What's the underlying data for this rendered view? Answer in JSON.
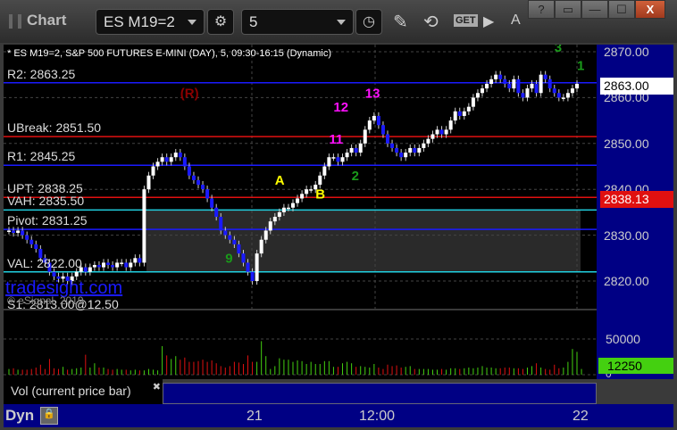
{
  "window": {
    "title": "Chart",
    "symbol": "ES M19=2",
    "interval": "5",
    "help": "?",
    "minimize": "—",
    "maximize": "☐",
    "close": "X"
  },
  "toolbar": {
    "pencil": "✎",
    "get": "GET",
    "play": "▶",
    "alert": "A"
  },
  "chart": {
    "description": "* ES M19=2, S&P 500 FUTURES E-MINI (DAY), 5, 09:30-16:15 (Dynamic)",
    "watermark": "tradesight.com",
    "copyright": "© eSignal, 2019",
    "current_price": "2863.00",
    "marker_price": "2838.13",
    "price_ticks": [
      "2870.00",
      "2860.00",
      "2850.00",
      "2840.00",
      "2830.00",
      "2820.00"
    ]
  },
  "levels": [
    {
      "label": "R2: 2863.25",
      "price": 2863.25,
      "color": "#1a1aff"
    },
    {
      "label": "UBreak: 2851.50",
      "price": 2851.5,
      "color": "#e01010"
    },
    {
      "label": "R1: 2845.25",
      "price": 2845.25,
      "color": "#1a1aff"
    },
    {
      "label": "UPT: 2838.25",
      "price": 2838.25,
      "color": "#e01010"
    },
    {
      "label": "VAH: 2835.50",
      "price": 2835.5,
      "color": "#20d0e0"
    },
    {
      "label": "Pivot: 2831.25",
      "price": 2831.25,
      "color": "#1a1aff"
    },
    {
      "label": "VAL: 2822.00",
      "price": 2822.0,
      "color": "#20d0e0"
    },
    {
      "label": "S1: 2813.00@12.50",
      "price": 2813.0,
      "color": "#1a1aff"
    }
  ],
  "volume": {
    "legend": "Vol (current price bar)",
    "current": "12250",
    "ticks": [
      "50000",
      "0"
    ]
  },
  "time_axis": {
    "mode": "Dyn",
    "labels": [
      "21",
      "12:00",
      "22"
    ]
  },
  "chart_data": {
    "type": "candlestick",
    "ylim": [
      2813,
      2872
    ],
    "closes": [
      2831,
      2830.5,
      2831,
      2830,
      2829,
      2828,
      2827,
      2825,
      2824,
      2822,
      2821,
      2820.5,
      2821,
      2820,
      2821,
      2822,
      2823,
      2822,
      2823,
      2823.5,
      2823,
      2824,
      2823.5,
      2823,
      2824,
      2824,
      2823,
      2824,
      2825,
      2824,
      2840,
      2843,
      2845,
      2846,
      2847,
      2846,
      2847,
      2848,
      2847,
      2845,
      2843,
      2842,
      2841,
      2840,
      2838,
      2836,
      2834,
      2831,
      2830,
      2829,
      2828,
      2826,
      2824,
      2822,
      2820,
      2826,
      2829,
      2831,
      2833,
      2834,
      2835,
      2836,
      2836,
      2837,
      2838,
      2839,
      2840,
      2840,
      2841,
      2843,
      2845,
      2847,
      2847,
      2846,
      2847,
      2848,
      2849,
      2848,
      2850,
      2853,
      2855,
      2856,
      2854,
      2852,
      2850,
      2849,
      2848,
      2847,
      2848,
      2849,
      2848,
      2849,
      2850,
      2851,
      2852,
      2853,
      2852,
      2853,
      2855,
      2857,
      2856,
      2857,
      2858,
      2860,
      2861,
      2862,
      2863,
      2864,
      2865,
      2864,
      2863,
      2862,
      2864,
      2861,
      2860,
      2862,
      2863,
      2861,
      2865,
      2864,
      2862,
      2861,
      2860,
      2860,
      2861,
      2862,
      2863
    ],
    "volumes": [
      8,
      9,
      7,
      7,
      7,
      8,
      10,
      14,
      8,
      22,
      9,
      8,
      11,
      7,
      8,
      9,
      10,
      28,
      10,
      16,
      10,
      10,
      8,
      7,
      8,
      7,
      7,
      6,
      7,
      6,
      6,
      8,
      7,
      6,
      40,
      27,
      22,
      26,
      21,
      24,
      18,
      18,
      19,
      21,
      18,
      20,
      16,
      12,
      10,
      12,
      18,
      17,
      15,
      27,
      18,
      18,
      47,
      26,
      8,
      12,
      23,
      21,
      21,
      18,
      20,
      19,
      15,
      18,
      15,
      15,
      19,
      19,
      11,
      11,
      16,
      18,
      16,
      11,
      12,
      11,
      10,
      15,
      10,
      8,
      14,
      12,
      13,
      10,
      11,
      12,
      8,
      8,
      8,
      8,
      7,
      7,
      8,
      7,
      9,
      9,
      8,
      9,
      10,
      9,
      10,
      12,
      10,
      10,
      9,
      9,
      10,
      10,
      9,
      9,
      8,
      10,
      12,
      16,
      10,
      8,
      7,
      14,
      9,
      10,
      18,
      36,
      32,
      8
    ]
  },
  "annotations": [
    {
      "text": "(R)",
      "bar": 38,
      "price": 2860,
      "color": "#8b0000"
    },
    {
      "text": "A",
      "bar": 59,
      "price": 2841,
      "color": "#ffff00"
    },
    {
      "text": "B",
      "bar": 68,
      "price": 2838,
      "color": "#ffff00"
    },
    {
      "text": "12",
      "bar": 72,
      "price": 2857,
      "color": "#ff10ff"
    },
    {
      "text": "11",
      "bar": 71,
      "price": 2850,
      "color": "#ff10ff"
    },
    {
      "text": "13",
      "bar": 79,
      "price": 2860,
      "color": "#ff10ff"
    },
    {
      "text": "9",
      "bar": 48,
      "price": 2824,
      "color": "#1a9a1a"
    },
    {
      "text": "2",
      "bar": 76,
      "price": 2842,
      "color": "#1a9a1a"
    },
    {
      "text": "1",
      "bar": 126,
      "price": 2866,
      "color": "#1a9a1a"
    },
    {
      "text": "3",
      "bar": 121,
      "price": 2870,
      "color": "#1a9a1a"
    }
  ]
}
